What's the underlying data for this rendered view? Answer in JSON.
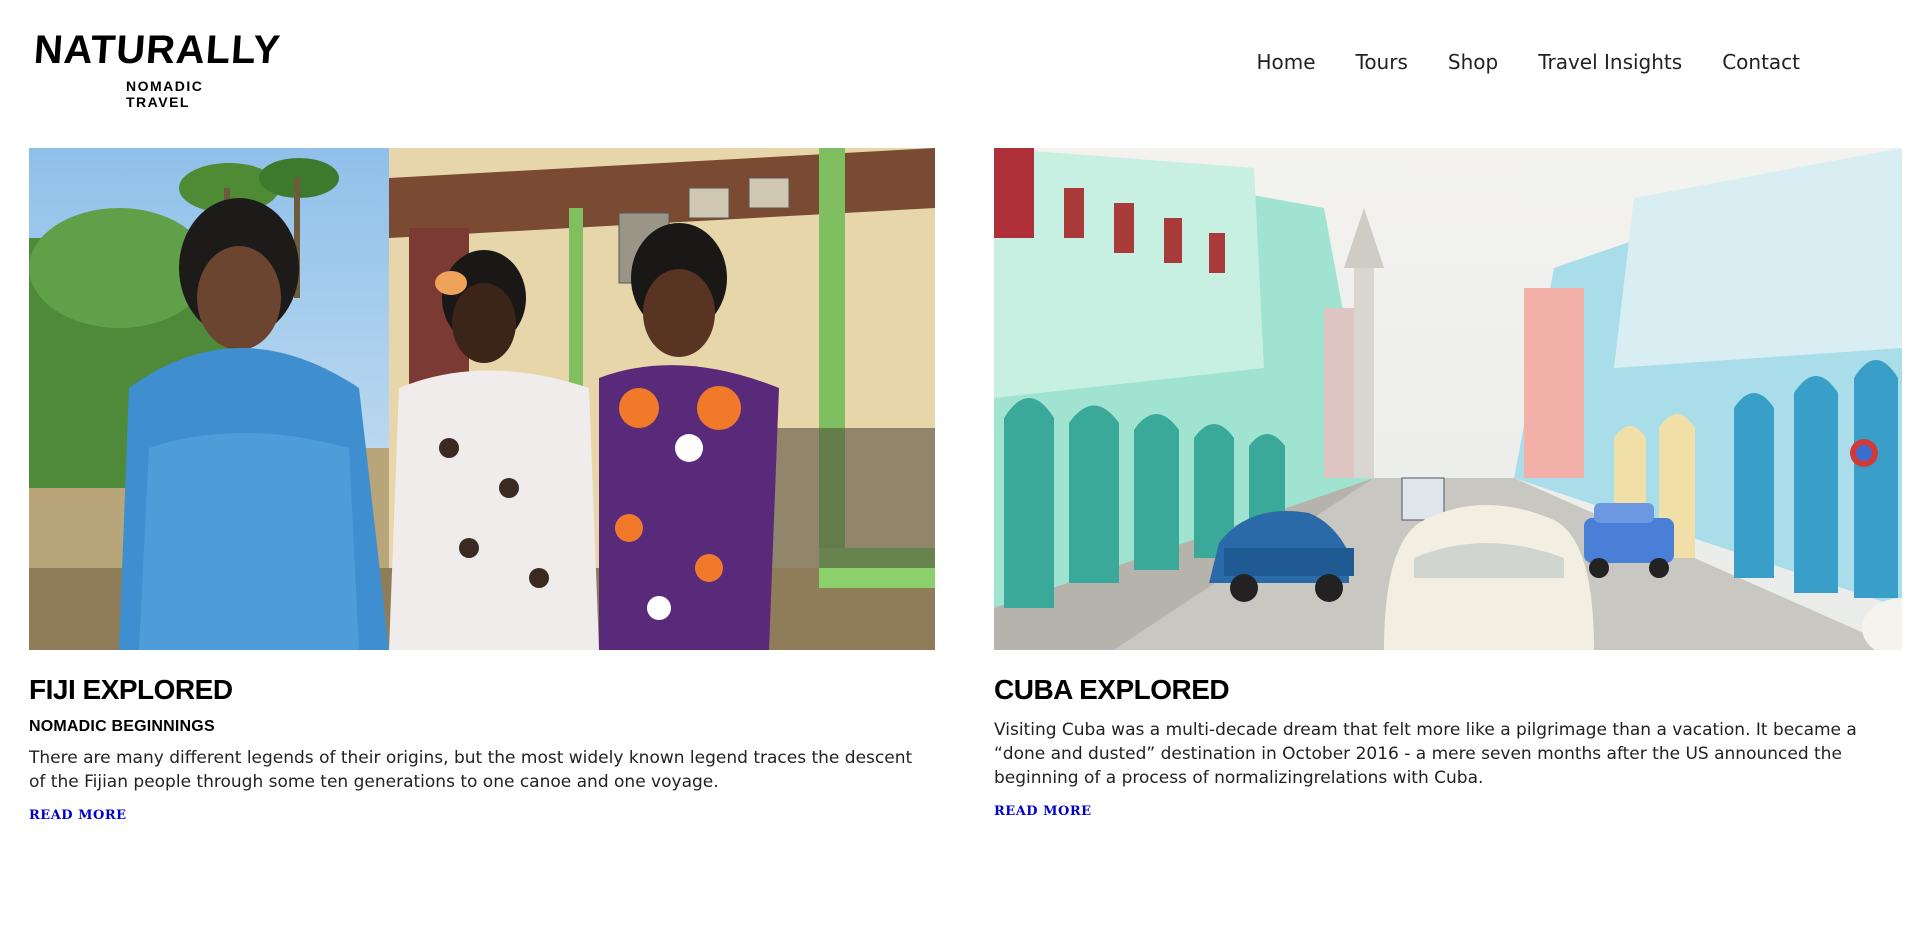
{
  "brand": {
    "name": "NATURALLY",
    "tagline": "NOMADIC TRAVEL"
  },
  "nav": [
    "Home",
    "Tours",
    "Shop",
    "Travel Insights",
    "Contact"
  ],
  "posts": [
    {
      "title": "FIJI EXPLORED",
      "subtitle": "NOMADIC BEGINNINGS",
      "excerpt": "There are many different legends of their origins, but the most widely known legend traces the descent of the Fijian people through some ten generations to one canoe and one voyage.",
      "link": "READ MORE",
      "image_description": "three-women-in-floral-dresses-photo"
    },
    {
      "title": "CUBA EXPLORED",
      "subtitle": "",
      "excerpt": "Visiting Cuba was a multi-decade dream that felt more like a pilgrimage than a vacation. It became a “done and dusted” destination in October 2016 - a mere seven months after the US announced the beginning of a process of normalizingrelations with Cuba.",
      "link": "READ MORE",
      "image_description": "havana-street-with-classic-cars-photo"
    }
  ],
  "colors": {
    "link": "#0000cc",
    "text": "#222222",
    "heading": "#000000"
  }
}
